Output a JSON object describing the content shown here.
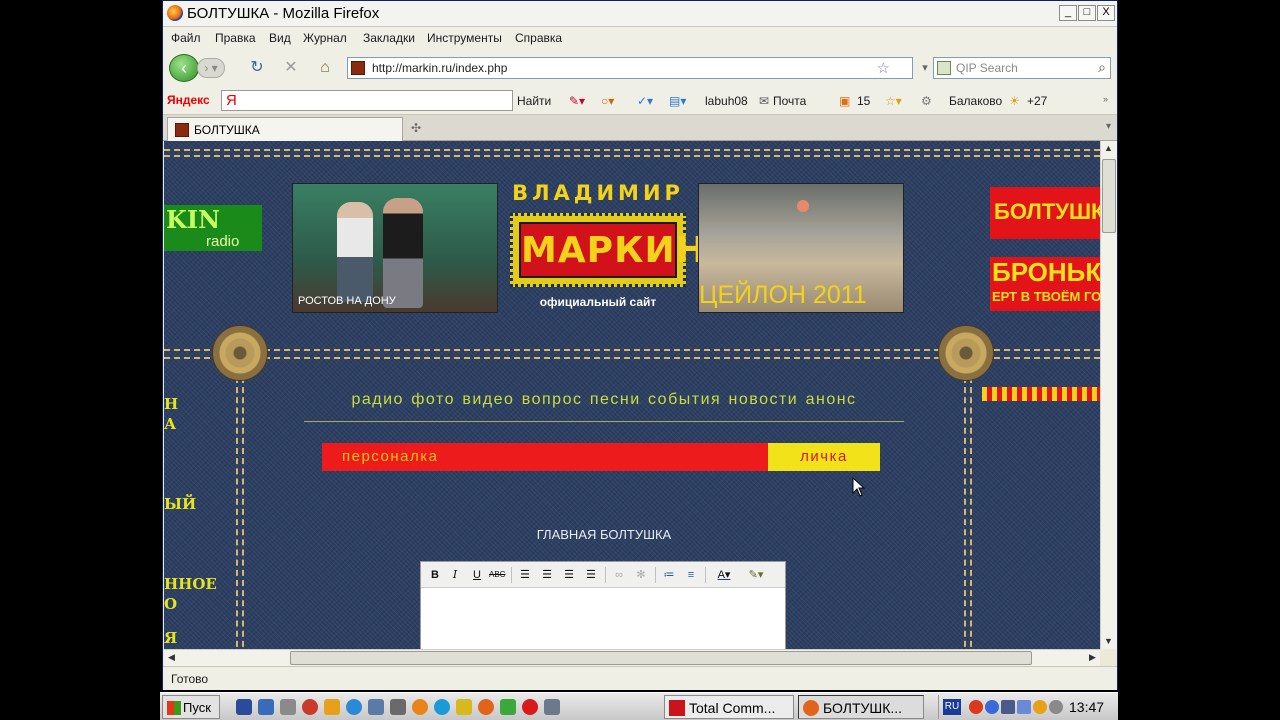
{
  "window": {
    "title": "БОЛТУШКА - Mozilla Firefox",
    "controls": [
      "_",
      "□",
      "X"
    ]
  },
  "menu": [
    "Файл",
    "Правка",
    "Вид",
    "Журнал",
    "Закладки",
    "Инструменты",
    "Справка"
  ],
  "navigation": {
    "url": "http://markin.ru/index.php",
    "search_placeholder": "QIP Search"
  },
  "yandex_bar": {
    "logo": "Яндекс",
    "input_prefix": "Я",
    "find": "Найти",
    "user": "labuh08",
    "mail": "Почта",
    "count": "15",
    "city": "Балаково",
    "temperature": "+27"
  },
  "tabs": [
    {
      "label": "БОЛТУШКА"
    }
  ],
  "page": {
    "promo_left": {
      "line1": "KIN",
      "line2": "radio"
    },
    "photo1_caption": "РОСТОВ НА ДОНУ",
    "logo": {
      "top": "ВЛАДИМИР",
      "name": "МАРКИН",
      "sub": "официальный сайт"
    },
    "photo2_caption": "ЦЕЙЛОН 2011",
    "promo_right_1": "БОЛТУШК",
    "promo_right_2": {
      "line1": "БРОНЬК",
      "line2": "ЕРТ В ТВОЁМ ГОР"
    },
    "left_fragments": [
      "Н",
      "А",
      "ЫЙ",
      "ННОЕ",
      "О",
      "Я"
    ],
    "nav": [
      "радио",
      "фото",
      "видео",
      "вопрос",
      "песни",
      "события",
      "новости",
      "анонс"
    ],
    "personalka": "персоналка",
    "lichka": "личка",
    "chat_heading": "ГЛАВНАЯ БОЛТУШКА",
    "editor_buttons": [
      "B",
      "I",
      "U",
      "ABC"
    ]
  },
  "status_text": "Готово",
  "taskbar": {
    "start": "Пуск",
    "buttons": [
      {
        "label": "Total Comm..."
      },
      {
        "label": "БОЛТУШК..."
      }
    ],
    "lang": "RU",
    "clock": "13:47"
  }
}
